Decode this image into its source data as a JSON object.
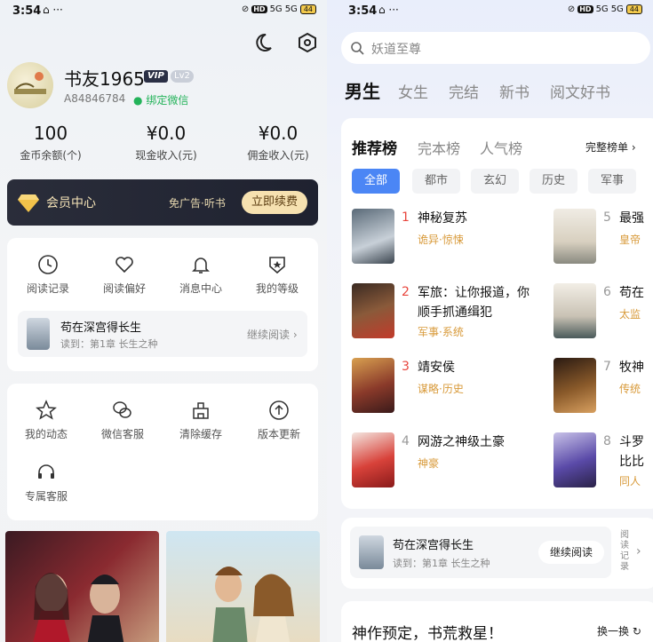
{
  "status": {
    "time": "3:54",
    "dots": "⌂ ···",
    "net": "5G",
    "hd": "HD",
    "battery": "44"
  },
  "profile": {
    "name": "书友1965",
    "vip_badge": "VIP",
    "level": "Lv2",
    "uid": "A84846784",
    "wechat": "绑定微信"
  },
  "stats": [
    {
      "value": "100",
      "label": "金币余额(个)"
    },
    {
      "value": "¥0.0",
      "label": "现金收入(元)"
    },
    {
      "value": "¥0.0",
      "label": "佣金收入(元)"
    }
  ],
  "vip_bar": {
    "title": "会员中心",
    "perks": "免广告·听书",
    "button": "立即续费"
  },
  "menu1": [
    {
      "label": "阅读记录",
      "icon": "clock-icon"
    },
    {
      "label": "阅读偏好",
      "icon": "heart-icon"
    },
    {
      "label": "消息中心",
      "icon": "bell-icon"
    },
    {
      "label": "我的等级",
      "icon": "level-icon"
    }
  ],
  "continue_left": {
    "title": "苟在深宫得长生",
    "progress": "读到：第1章 长生之种",
    "action": "继续阅读"
  },
  "menu2": [
    {
      "label": "我的动态",
      "icon": "star-icon"
    },
    {
      "label": "微信客服",
      "icon": "wechat-icon"
    },
    {
      "label": "清除缓存",
      "icon": "broom-icon"
    },
    {
      "label": "版本更新",
      "icon": "upload-icon"
    },
    {
      "label": "专属客服",
      "icon": "headset-icon"
    }
  ],
  "search": {
    "placeholder": "妖道至尊"
  },
  "tabs": [
    "男生",
    "女生",
    "完结",
    "新书",
    "阅文好书"
  ],
  "rank": {
    "tabs": [
      "推荐榜",
      "完本榜",
      "人气榜"
    ],
    "full": "完整榜单",
    "chips": [
      "全部",
      "都市",
      "玄幻",
      "历史",
      "军事"
    ],
    "items_left": [
      {
        "n": "1",
        "title": "神秘复苏",
        "tag": "诡异·惊悚"
      },
      {
        "n": "2",
        "title": "军旅：让你报道，你顺手抓通缉犯",
        "tag": "军事·系统"
      },
      {
        "n": "3",
        "title": "靖安侯",
        "tag": "谋略·历史"
      },
      {
        "n": "4",
        "title": "网游之神级土豪",
        "tag": "神豪"
      }
    ],
    "items_right": [
      {
        "n": "5",
        "title": "最强",
        "tag": "皇帝"
      },
      {
        "n": "6",
        "title": "苟在",
        "tag": "太监"
      },
      {
        "n": "7",
        "title": "牧神",
        "tag": "传统"
      },
      {
        "n": "8",
        "title": "斗罗",
        "title2": "比比",
        "tag": "同人"
      }
    ]
  },
  "continue_right": {
    "title": "苟在深宫得长生",
    "progress": "读到：第1章 长生之种",
    "action": "继续阅读",
    "side": "阅读记录"
  },
  "promo": {
    "title": "神作预定，书荒救星！",
    "refresh": "换一换"
  },
  "colors": {
    "accent": "#4b86f5",
    "red": "#e8453c",
    "gold": "#d89a3a",
    "green": "#24b35a"
  }
}
